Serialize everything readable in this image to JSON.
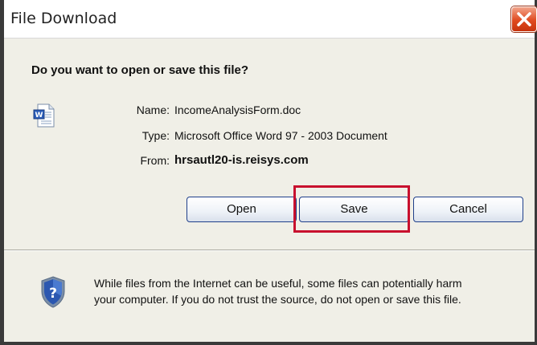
{
  "dialog": {
    "title": "File Download",
    "question": "Do you want to open or save this file?"
  },
  "file": {
    "icon": "word-document-icon",
    "name_label": "Name:",
    "name_value": "IncomeAnalysisForm.doc",
    "type_label": "Type:",
    "type_value": "Microsoft Office Word 97 - 2003 Document",
    "from_label": "From:",
    "from_value": "hrsautl20-is.reisys.com"
  },
  "buttons": {
    "open_label": "Open",
    "save_label": "Save",
    "cancel_label": "Cancel"
  },
  "warning": {
    "icon": "shield-question-icon",
    "line1": "While files from the Internet can be useful, some files can potentially harm",
    "line2": "your computer. If you do not trust the source, do not open or save this file."
  },
  "colors": {
    "highlight": "#c8102e",
    "close_button": "#e04a1f",
    "dialog_body": "#f0efe7",
    "button_border": "#1f3f8a"
  }
}
